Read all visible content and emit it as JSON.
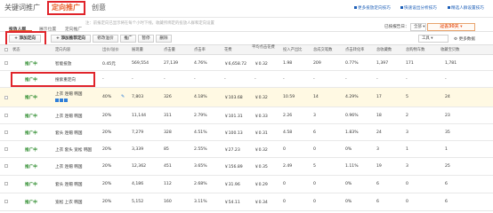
{
  "top_tabs": [
    "关键词推广",
    "定向推广",
    "创意"
  ],
  "tips": [
    "更多投放定向技巧",
    "快速设出分析技巧",
    "精选人群设置技巧"
  ],
  "hint": "注：前报定向已显示将在每个小时下线，收藏所绑定的投放人群和定向设置",
  "date_info": "已按报告日：",
  "date_select": "全部",
  "period_label": "过去30天",
  "subtabs": [
    "投放人群",
    "展示位置",
    "定向推广"
  ],
  "toolbar": {
    "add_targeting": "添加定向",
    "add_custom": "添加推荐定向",
    "modify_price": "修改溢价",
    "promote": "推广",
    "pause": "暂停",
    "delete": "删除",
    "tools_label": "工具",
    "more_data": "更多数据"
  },
  "headers": [
    "状态",
    "定向内容",
    "出价/溢价",
    "展现量",
    "点击量",
    "点击率",
    "花费",
    "平均点击花费",
    "投入产出比",
    "总成交笔数",
    "点击转化率",
    "总收藏数",
    "总购物车数",
    "收藏宝贝数"
  ],
  "rows": [
    {
      "status": "推广中",
      "name": "智能投放",
      "price": "0.45元",
      "impr": "569,554",
      "clicks": "27,139",
      "ctr": "4.76%",
      "cost": "￥6,658.72",
      "cpc": "￥0.32",
      "roi": "1.98",
      "deals": "209",
      "cvr": "0.77%",
      "fav": "1,397",
      "cart": "171",
      "favitem": "1,781"
    },
    {
      "status": "推广中",
      "name": "搜索重定向",
      "price": "-",
      "impr": "-",
      "clicks": "-",
      "ctr": "-",
      "cost": "-",
      "cpc": "-",
      "roi": "-",
      "deals": "-",
      "cvr": "-",
      "fav": "-",
      "cart": "-",
      "favitem": "-"
    },
    {
      "status": "推广中",
      "name": "上衣 连帽 韩国",
      "price": "40%",
      "impr": "7,803",
      "clicks": "326",
      "ctr": "4.18%",
      "cost": "￥103.68",
      "cpc": "￥0.32",
      "roi": "10.59",
      "deals": "14",
      "cvr": "4.29%",
      "fav": "17",
      "cart": "5",
      "favitem": "24"
    },
    {
      "status": "推广中",
      "name": "上衣 连帽 韩国",
      "price": "20%",
      "impr": "11,144",
      "clicks": "311",
      "ctr": "2.79%",
      "cost": "￥101.31",
      "cpc": "￥0.33",
      "roi": "2.26",
      "deals": "3",
      "cvr": "0.96%",
      "fav": "18",
      "cart": "2",
      "favitem": "23"
    },
    {
      "status": "推广中",
      "name": "套头 连帽 韩国",
      "price": "20%",
      "impr": "7,279",
      "clicks": "328",
      "ctr": "4.51%",
      "cost": "￥100.13",
      "cpc": "￥0.31",
      "roi": "4.58",
      "deals": "6",
      "cvr": "1.83%",
      "fav": "24",
      "cart": "3",
      "favitem": "35"
    },
    {
      "status": "推广中",
      "name": "上衣 套头 宽松 韩国",
      "price": "20%",
      "impr": "3,339",
      "clicks": "85",
      "ctr": "2.55%",
      "cost": "￥27.23",
      "cpc": "￥0.32",
      "roi": "0",
      "deals": "0",
      "cvr": "0%",
      "fav": "3",
      "cart": "1",
      "favitem": "1"
    },
    {
      "status": "推广中",
      "name": "上衣 连帽 韩国",
      "price": "20%",
      "impr": "12,362",
      "clicks": "451",
      "ctr": "3.65%",
      "cost": "￥156.89",
      "cpc": "￥0.35",
      "roi": "2.49",
      "deals": "5",
      "cvr": "1.11%",
      "fav": "19",
      "cart": "3",
      "favitem": "25"
    },
    {
      "status": "推广中",
      "name": "套头 连帽 韩国",
      "price": "20%",
      "impr": "4,186",
      "clicks": "112",
      "ctr": "2.68%",
      "cost": "￥31.96",
      "cpc": "￥0.29",
      "roi": "0",
      "deals": "0",
      "cvr": "0%",
      "fav": "6",
      "cart": "0",
      "favitem": "6"
    },
    {
      "status": "推广中",
      "name": "宽松 上衣 韩国",
      "price": "20%",
      "impr": "5,152",
      "clicks": "160",
      "ctr": "3.11%",
      "cost": "￥54.11",
      "cpc": "￥0.34",
      "roi": "0",
      "deals": "0",
      "cvr": "0%",
      "fav": "6",
      "cart": "0",
      "favitem": "6"
    }
  ]
}
